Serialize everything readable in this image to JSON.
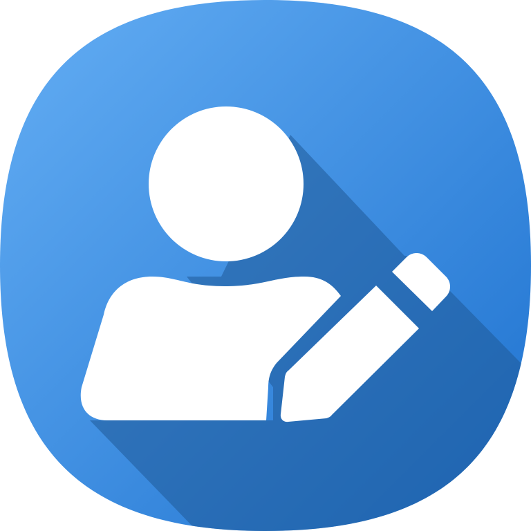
{
  "icon": {
    "name": "edit-profile-icon",
    "glyph": "user-with-pencil",
    "colors": {
      "gradient_start": "#64AEF4",
      "gradient_end": "#1D71CF",
      "glyph": "#FFFFFF",
      "long_shadow": "#1F5A98"
    }
  }
}
